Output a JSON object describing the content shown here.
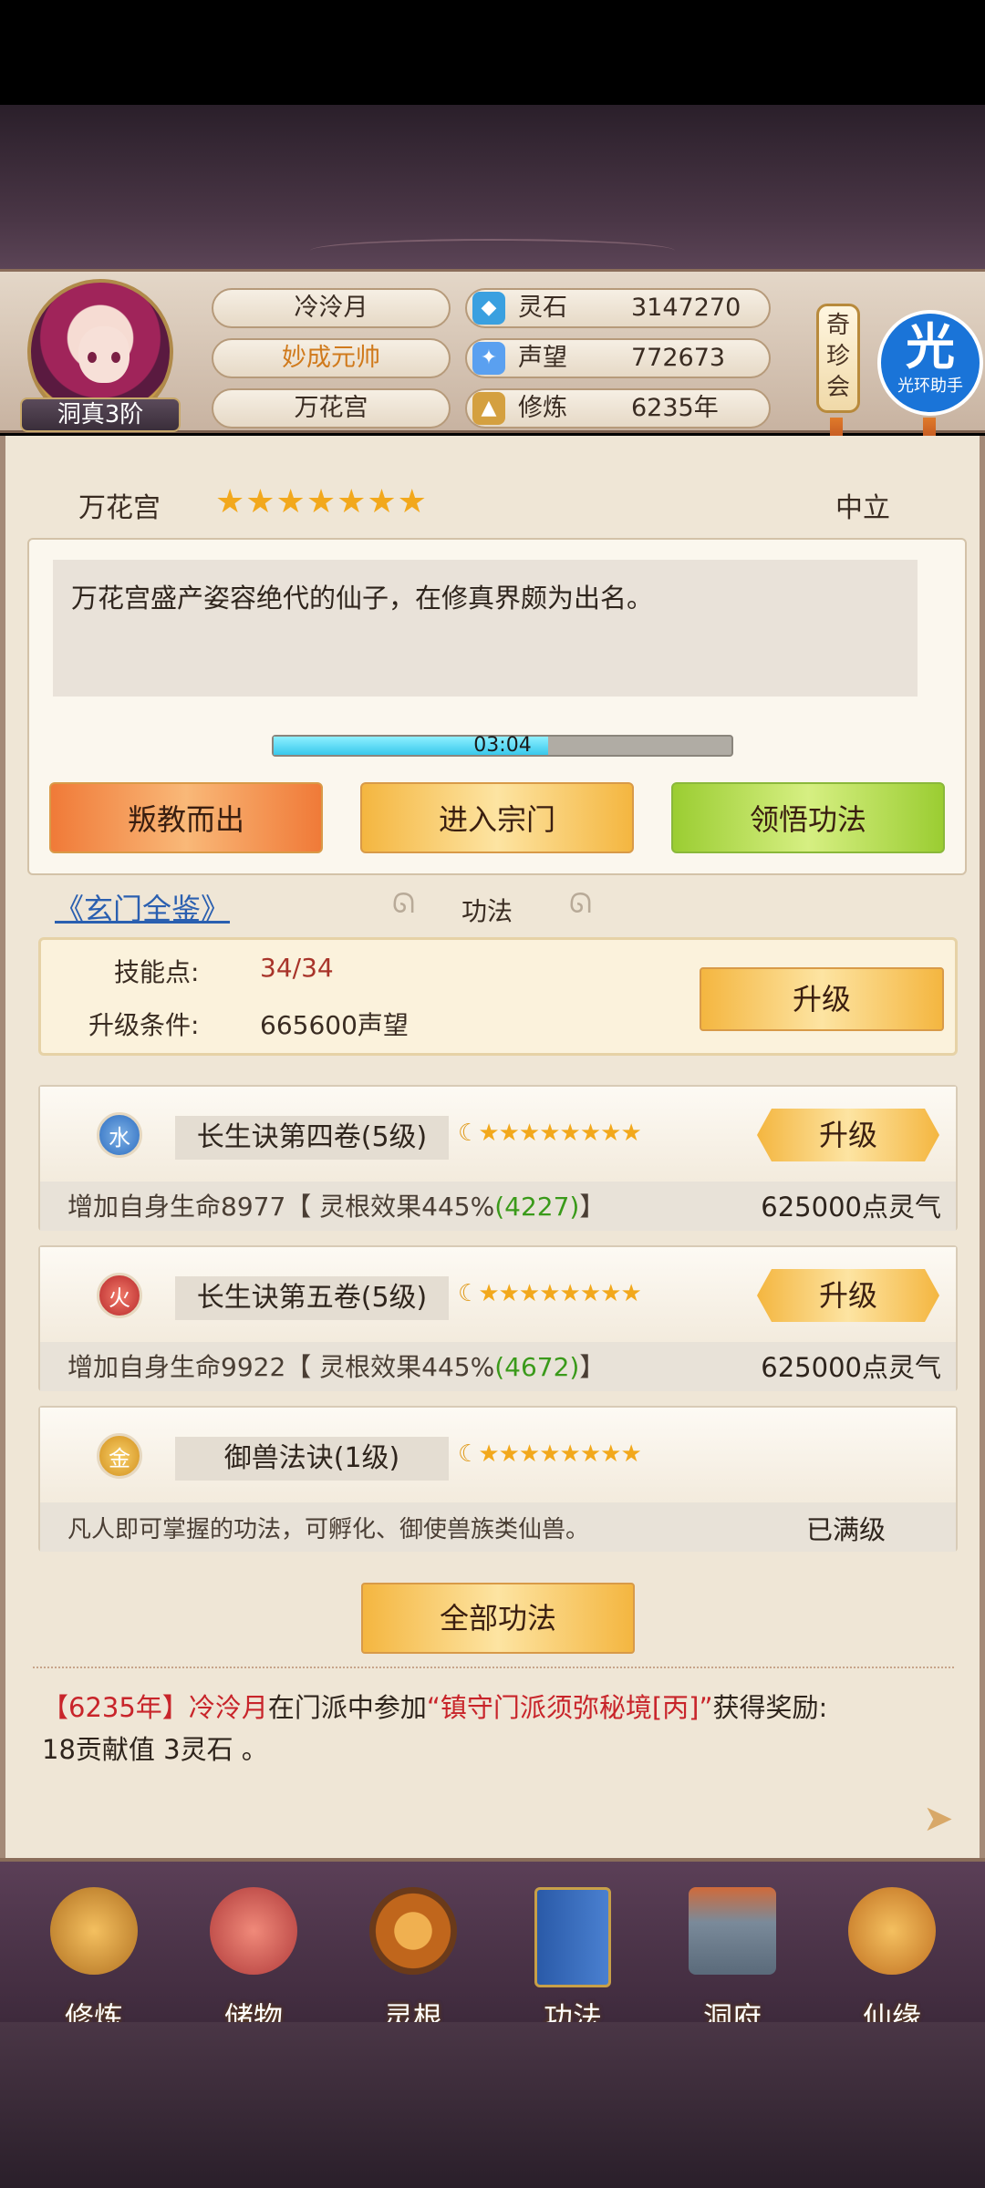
{
  "player": {
    "name": "冷泠月",
    "title": "妙成元帅",
    "sect": "万花宫",
    "rank": "洞真3阶"
  },
  "resources": [
    {
      "label": "灵石",
      "value": "3147270",
      "icon": "spirit-stone-icon",
      "color": "#3aa0e0"
    },
    {
      "label": "声望",
      "value": "772673",
      "icon": "reputation-icon",
      "color": "#5aa0f0"
    },
    {
      "label": "修炼",
      "value": "6235年",
      "icon": "meditation-icon",
      "color": "#d4a040"
    }
  ],
  "qizhen": "奇珍会",
  "helper": {
    "big": "光",
    "small": "光环助手"
  },
  "sect_panel": {
    "name": "万花宫",
    "stars": "★★★★★★★",
    "stance": "中立",
    "description": "万花宫盛产姿容绝代的仙子，在修真界颇为出名。",
    "timer": "03:04",
    "timer_progress": 0.6,
    "buttons": {
      "leave": "叛教而出",
      "enter": "进入宗门",
      "learn": "领悟功法"
    }
  },
  "guide_link": "《玄门全鉴》",
  "gongfa_title": "功法",
  "skill_points": {
    "label": "技能点:",
    "value": "34/34",
    "cond_label": "升级条件:",
    "cond_value": "665600声望",
    "upgrade": "升级"
  },
  "techniques": [
    {
      "element": "水",
      "name": "长生诀第四卷(5级)",
      "stars": "★★★★★★★★",
      "desc_main": "增加自身生命8977【 灵根效果445%",
      "desc_green": "(4227)",
      "desc_end": "】",
      "cost": "625000点灵气",
      "button": "升级"
    },
    {
      "element": "火",
      "name": "长生诀第五卷(5级)",
      "stars": "★★★★★★★★",
      "desc_main": "增加自身生命9922【 灵根效果445%",
      "desc_green": "(4672)",
      "desc_end": "】",
      "cost": "625000点灵气",
      "button": "升级"
    },
    {
      "element": "金",
      "name": "御兽法诀(1级)",
      "stars": "★★★★★★★★",
      "desc": "凡人即可掌握的功法，可孵化、御使兽族类仙兽。",
      "status": "已满级"
    }
  ],
  "all_gongfa": "全部功法",
  "log": {
    "year": "【6235年】",
    "name": "冷泠月",
    "mid": "在门派中参加",
    "event": "“镇守门派须弥秘境[丙]”",
    "tail": "获得奖励:",
    "line2": "18贡献值 3灵石 。"
  },
  "nav": [
    {
      "label": "修炼",
      "icon": "cultivate-icon"
    },
    {
      "label": "储物",
      "icon": "storage-bag-icon"
    },
    {
      "label": "灵根",
      "icon": "spirit-root-icon"
    },
    {
      "label": "功法",
      "icon": "technique-book-icon"
    },
    {
      "label": "洞府",
      "icon": "cave-dwelling-icon"
    },
    {
      "label": "仙缘",
      "icon": "fate-gourd-icon"
    }
  ]
}
